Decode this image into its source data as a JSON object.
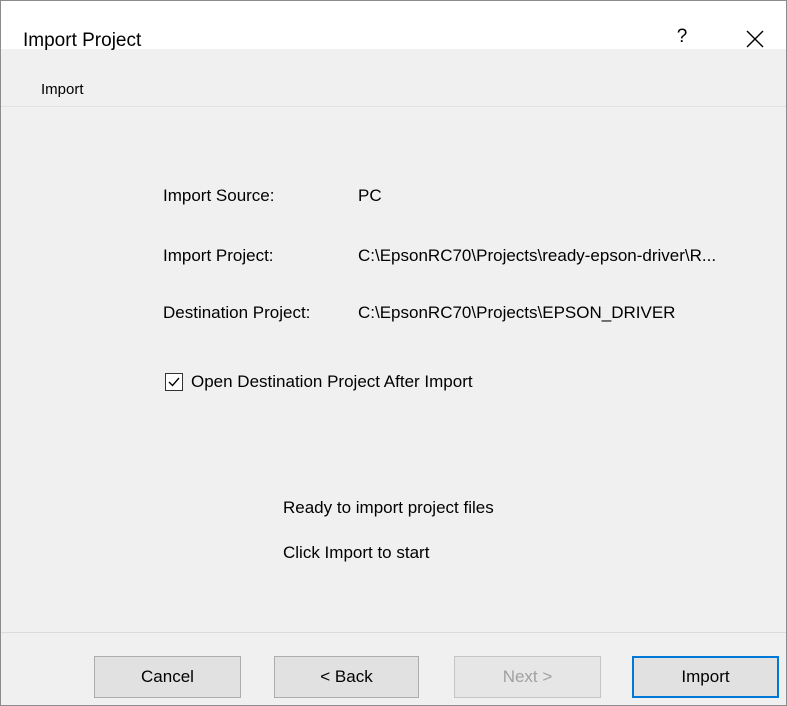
{
  "window": {
    "title": "Import Project",
    "help_label": "?",
    "close_icon": "close-icon"
  },
  "section": {
    "label": "Import"
  },
  "details": [
    {
      "label": "Import Source:",
      "value": "PC"
    },
    {
      "label": "Import Project:",
      "value": "C:\\EpsonRC70\\Projects\\ready-epson-driver\\R..."
    },
    {
      "label": "Destination Project:",
      "value": "C:\\EpsonRC70\\Projects\\EPSON_DRIVER"
    }
  ],
  "option": {
    "label": "Open Destination Project After Import",
    "checked": true
  },
  "status": {
    "line1": "Ready to import project files",
    "line2": "Click Import to start"
  },
  "buttons": {
    "cancel": "Cancel",
    "back": "< Back",
    "next": "Next >",
    "import": "Import"
  },
  "colors": {
    "accent": "#0078d7",
    "background": "#f0f0f0",
    "button_face": "#e1e1e1"
  }
}
